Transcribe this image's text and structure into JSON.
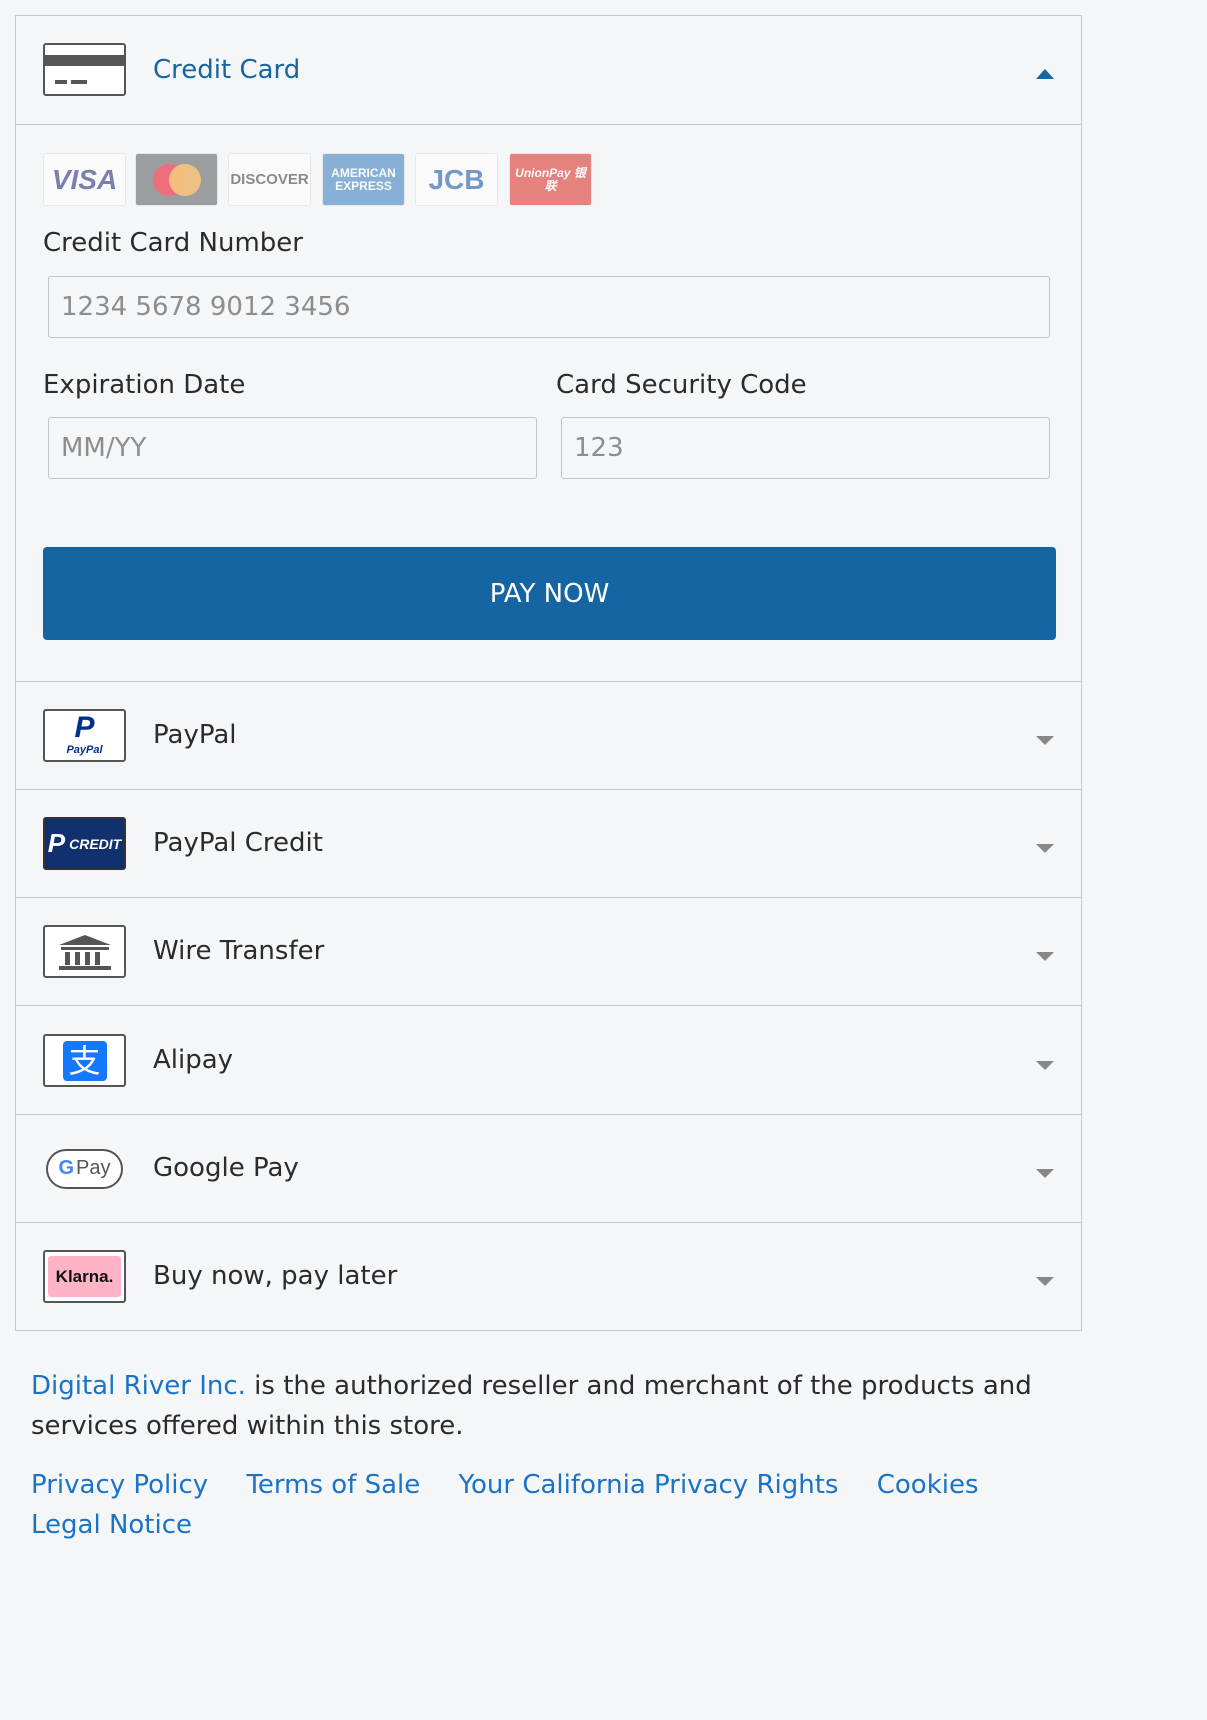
{
  "credit_card": {
    "label": "Credit Card",
    "brands": [
      "VISA",
      "",
      "DISCOVER",
      "AMERICAN EXPRESS",
      "JCB",
      "UnionPay 银联"
    ],
    "number_label": "Credit Card Number",
    "number_placeholder": "1234 5678 9012 3456",
    "expiry_label": "Expiration Date",
    "expiry_placeholder": "MM/YY",
    "cvc_label": "Card Security Code",
    "cvc_placeholder": "123",
    "pay_button": "PAY NOW"
  },
  "methods": [
    {
      "label": "PayPal",
      "icon": "paypal-icon",
      "icon_text": "PayPal"
    },
    {
      "label": "PayPal Credit",
      "icon": "paypal-credit-icon",
      "icon_text": "CREDIT"
    },
    {
      "label": "Wire Transfer",
      "icon": "bank-icon"
    },
    {
      "label": "Alipay",
      "icon": "alipay-icon",
      "icon_text": "支"
    },
    {
      "label": "Google Pay",
      "icon": "google-pay-icon",
      "icon_text": "Pay"
    },
    {
      "label": "Buy now, pay later",
      "icon": "klarna-icon",
      "icon_text": "Klarna."
    }
  ],
  "footer": {
    "merchant_link": "Digital River Inc.",
    "merchant_text": " is the authorized reseller and merchant of the products and services offered within this store.",
    "links": [
      "Privacy Policy",
      "Terms of Sale",
      "Your California Privacy Rights",
      "Cookies",
      "Legal Notice"
    ]
  },
  "colors": {
    "accent": "#1565a3",
    "link": "#1a73c6",
    "background": "#f5f6f8"
  }
}
